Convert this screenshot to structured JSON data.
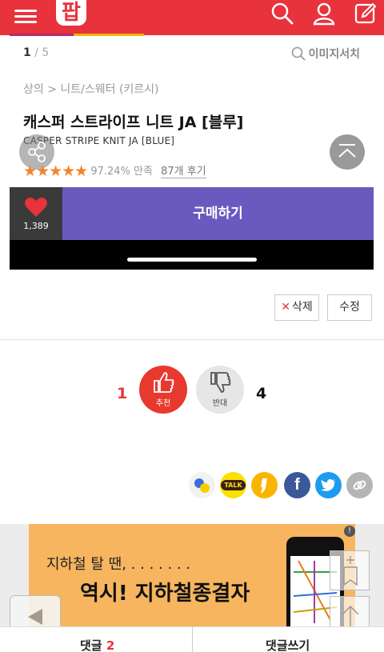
{
  "header": {
    "logo_text": "팝",
    "brand_color": "#e8323c"
  },
  "pager": {
    "current": "1",
    "separator": " / ",
    "total": "5"
  },
  "image_search_label": "이미지서치",
  "breadcrumb": "상의 > 니트/스웨터 (키르시)",
  "product": {
    "title": "캐스퍼 스트라이프 니트 JA [블루]",
    "subtitle": "CASPER STRIPE KNIT JA [BLUE]",
    "stars": "★★★★★",
    "satisfaction": "97.24% 만족",
    "reviews": "87개 후기"
  },
  "buy": {
    "like_count": "1,389",
    "buy_label": "구매하기",
    "buy_color": "#6a5ac0"
  },
  "actions": {
    "delete_label": "삭제",
    "edit_label": "수정"
  },
  "votes": {
    "up_count": "1",
    "up_label": "추천",
    "down_count": "4",
    "down_label": "반대"
  },
  "social": {
    "kakaotalk_label": "TALK",
    "facebook_label": "f"
  },
  "banner": {
    "line1": "지하철 탈 땐,  .  .  .  .  .  .  .",
    "line2": "역시! 지하철종결자",
    "ad_badge": "!"
  },
  "tabs": {
    "comments_label": "댓글",
    "comments_count": "2",
    "write_label": "댓글쓰기"
  }
}
